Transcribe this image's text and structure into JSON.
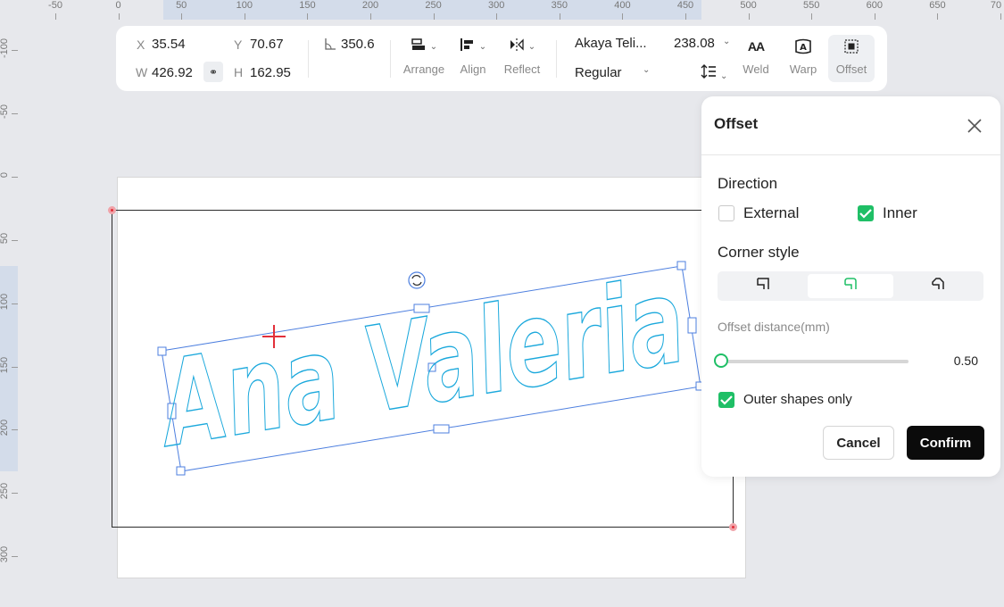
{
  "ruler": {
    "top_labels": [
      "-50",
      "0",
      "50",
      "100",
      "150",
      "200",
      "250",
      "300",
      "350",
      "400",
      "450",
      "500",
      "550",
      "600",
      "650",
      "70"
    ],
    "left_labels": [
      "-100",
      "-50",
      "0",
      "50",
      "100",
      "150",
      "200",
      "250",
      "300"
    ]
  },
  "toolbar": {
    "x_label": "X",
    "x_value": "35.54",
    "y_label": "Y",
    "y_value": "70.67",
    "w_label": "W",
    "w_value": "426.92",
    "h_label": "H",
    "h_value": "162.95",
    "rotation_value": "350.6",
    "arrange_label": "Arrange",
    "align_label": "Align",
    "reflect_label": "Reflect",
    "font_family": "Akaya Teli...",
    "font_size": "238.08",
    "font_style": "Regular",
    "weld_label": "Weld",
    "warp_label": "Warp",
    "offset_label": "Offset"
  },
  "canvas": {
    "design_text": "Ana Valeria",
    "outline_color": "#1aa8dc",
    "selection_color": "#4d7fdf"
  },
  "offset_panel": {
    "title": "Offset",
    "direction_heading": "Direction",
    "external_label": "External",
    "external_checked": false,
    "inner_label": "Inner",
    "inner_checked": true,
    "corner_style_heading": "Corner style",
    "corner_styles": [
      "square-corner-icon",
      "round-corner-icon",
      "bevel-corner-icon"
    ],
    "corner_selected": "round-corner-icon",
    "offset_distance_label": "Offset distance(mm)",
    "offset_distance_value": "0.50",
    "outer_shapes_label": "Outer shapes only",
    "outer_shapes_checked": true,
    "cancel_label": "Cancel",
    "confirm_label": "Confirm",
    "accent_color": "#1fbf66"
  }
}
